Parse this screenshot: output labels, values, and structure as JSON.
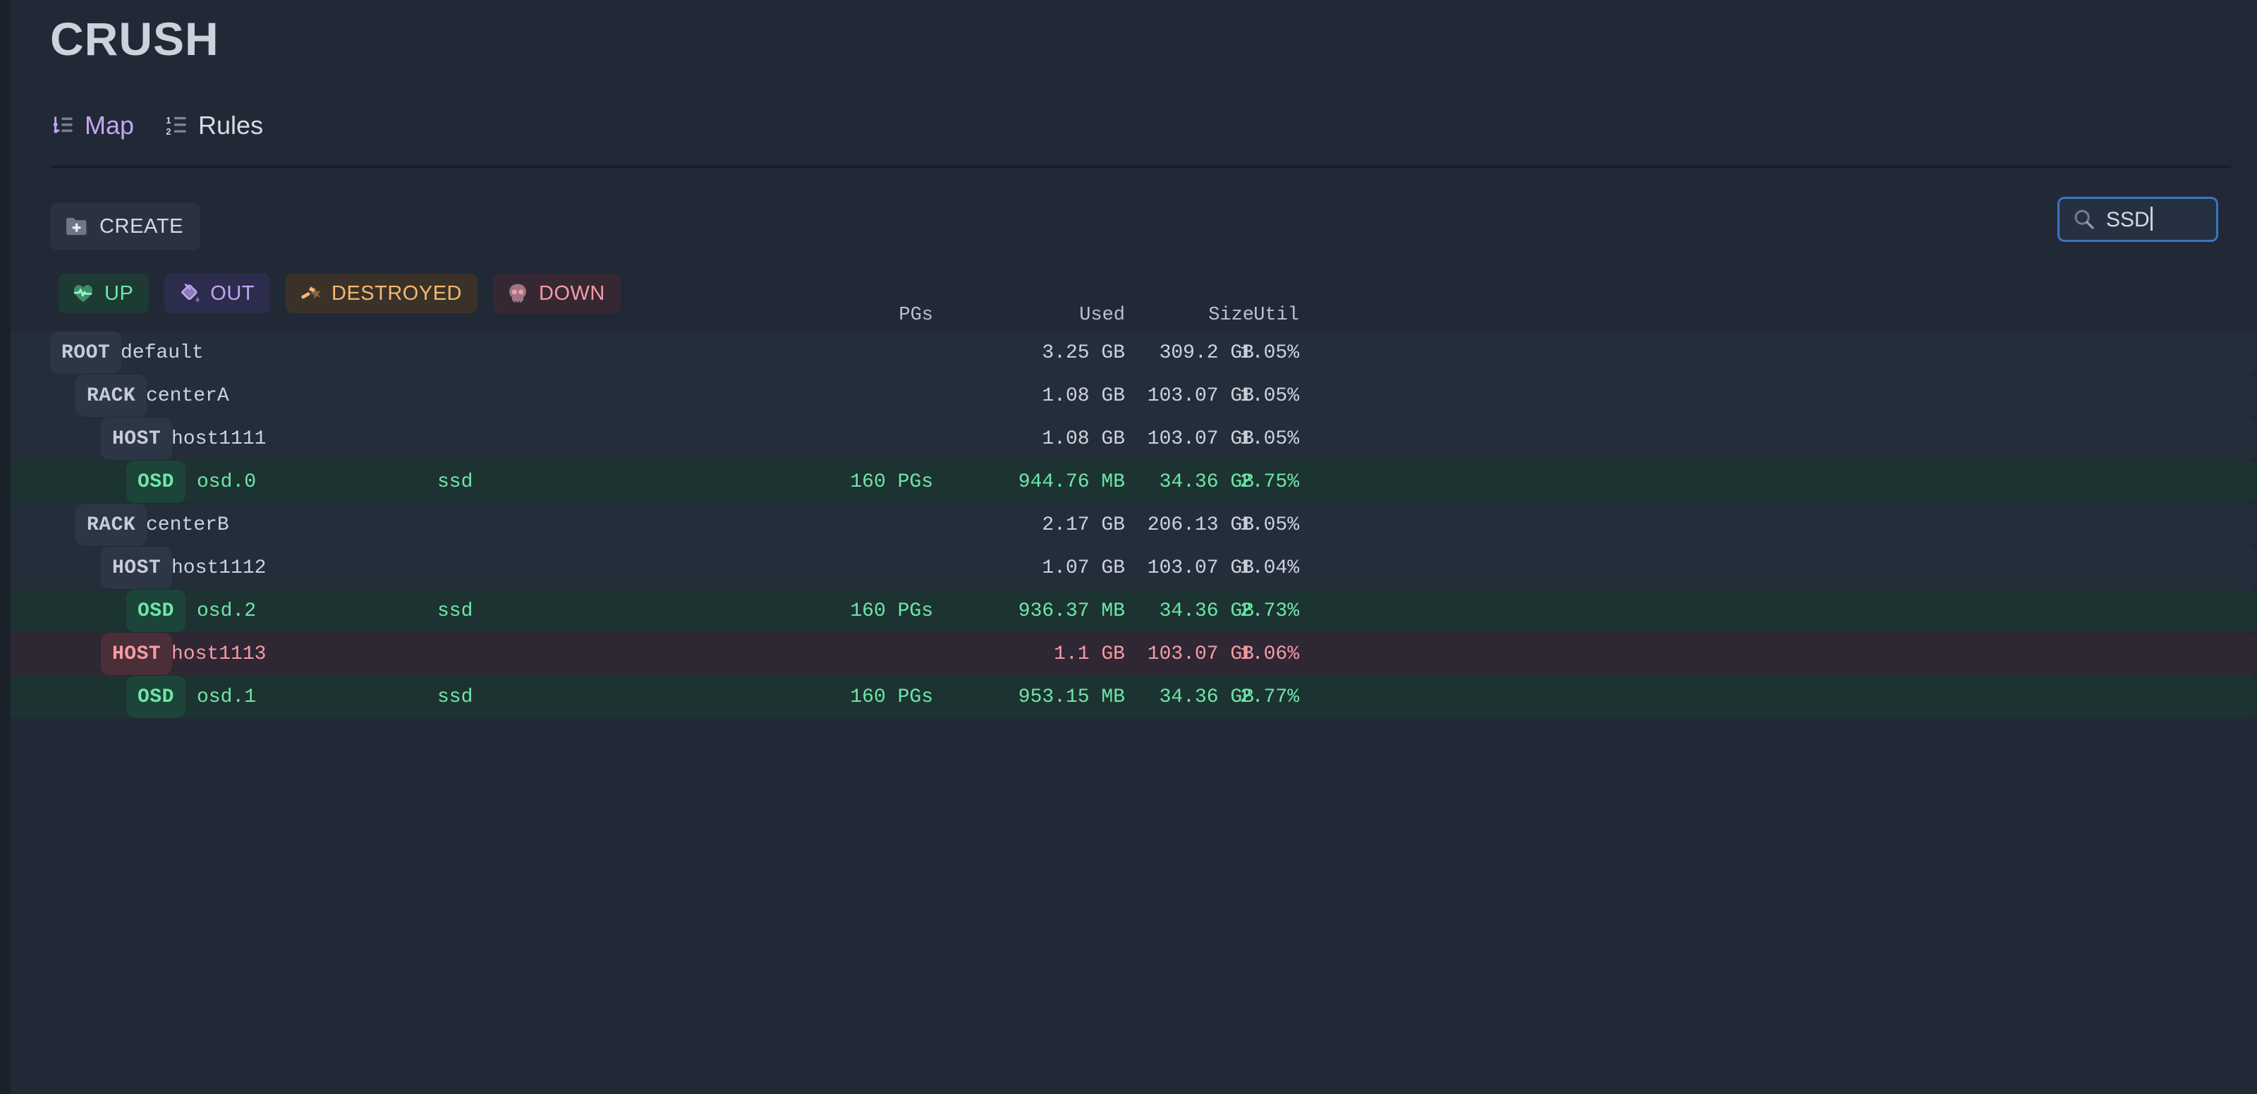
{
  "app": {
    "title": "CRUSH"
  },
  "tabs": [
    {
      "label": "Map",
      "icon": "tree-list-icon",
      "active": true
    },
    {
      "label": "Rules",
      "icon": "numbered-list-icon",
      "active": false
    }
  ],
  "toolbar": {
    "create_label": "CREATE",
    "create_icon": "folder-plus-icon"
  },
  "search": {
    "value": "SSD",
    "icon": "search-icon"
  },
  "status_filters": [
    {
      "label": "UP",
      "icon": "heart-pulse-icon",
      "variant": "up"
    },
    {
      "label": "OUT",
      "icon": "paint-bucket-icon",
      "variant": "out"
    },
    {
      "label": "DESTROYED",
      "icon": "hammer-smash-icon",
      "variant": "destroyed"
    },
    {
      "label": "DOWN",
      "icon": "skull-icon",
      "variant": "down"
    }
  ],
  "table": {
    "columns": [
      {
        "key": "pgs",
        "label": "PGs"
      },
      {
        "key": "used",
        "label": "Used"
      },
      {
        "key": "size",
        "label": "Size"
      },
      {
        "key": "util",
        "label": "Util"
      }
    ],
    "rows": [
      {
        "type": "ROOT",
        "name": "default",
        "device_class": "",
        "depth": 0,
        "style": "default",
        "pgs": "",
        "used": "3.25 GB",
        "size": "309.2 GB",
        "util": "1.05%"
      },
      {
        "type": "RACK",
        "name": "centerA",
        "device_class": "",
        "depth": 1,
        "style": "default",
        "pgs": "",
        "used": "1.08 GB",
        "size": "103.07 GB",
        "util": "1.05%"
      },
      {
        "type": "HOST",
        "name": "host1111",
        "device_class": "",
        "depth": 2,
        "style": "default",
        "pgs": "",
        "used": "1.08 GB",
        "size": "103.07 GB",
        "util": "1.05%"
      },
      {
        "type": "OSD",
        "name": "osd.0",
        "device_class": "ssd",
        "depth": 3,
        "style": "osd",
        "pgs": "160 PGs",
        "used": "944.76 MB",
        "size": "34.36 GB",
        "util": "2.75%"
      },
      {
        "type": "RACK",
        "name": "centerB",
        "device_class": "",
        "depth": 1,
        "style": "default",
        "pgs": "",
        "used": "2.17 GB",
        "size": "206.13 GB",
        "util": "1.05%"
      },
      {
        "type": "HOST",
        "name": "host1112",
        "device_class": "",
        "depth": 2,
        "style": "default",
        "pgs": "",
        "used": "1.07 GB",
        "size": "103.07 GB",
        "util": "1.04%"
      },
      {
        "type": "OSD",
        "name": "osd.2",
        "device_class": "ssd",
        "depth": 3,
        "style": "osd",
        "pgs": "160 PGs",
        "used": "936.37 MB",
        "size": "34.36 GB",
        "util": "2.73%"
      },
      {
        "type": "HOST",
        "name": "host1113",
        "device_class": "",
        "depth": 2,
        "style": "down",
        "pgs": "",
        "used": "1.1 GB",
        "size": "103.07 GB",
        "util": "1.06%"
      },
      {
        "type": "OSD",
        "name": "osd.1",
        "device_class": "ssd",
        "depth": 3,
        "style": "osd",
        "pgs": "160 PGs",
        "used": "953.15 MB",
        "size": "34.36 GB",
        "util": "2.77%"
      }
    ]
  },
  "colors": {
    "background": "#212936",
    "accent_purple": "#c3a6f0",
    "up_green": "#6ee7a8",
    "destroyed_orange": "#f5b870",
    "down_red": "#f79ba4",
    "focus_blue": "#3b74c4"
  }
}
